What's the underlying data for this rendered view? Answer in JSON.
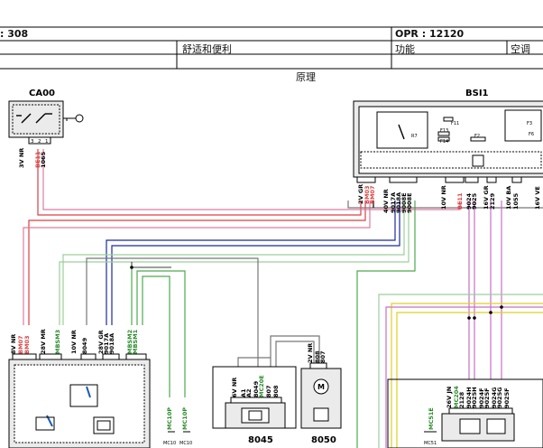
{
  "header": {
    "left_code": ": 308",
    "opr_code": "OPR : 12120",
    "category": "舒适和便利",
    "function_label": "功能",
    "function_value": "空调",
    "section_title": "原理"
  },
  "components": {
    "ca00": {
      "title": "CA00",
      "wire_labels": [
        "3V NR",
        "BE11",
        "1065"
      ],
      "pin_labels": [
        "3",
        "2",
        "1"
      ]
    },
    "bsi1": {
      "title": "BSI1",
      "internal_labels": [
        "R7",
        "F11",
        "F13",
        "F14",
        "F2",
        "F3",
        "F6"
      ],
      "conn_groups": [
        {
          "label": "2V GR",
          "wires": [
            "BM03",
            "BM07"
          ],
          "pins": [
            "1",
            "2"
          ]
        },
        {
          "label": "40V NR",
          "wires": [
            "9017A",
            "9018A",
            "9008E",
            "9008E"
          ],
          "pins": [
            "37",
            "21",
            "4",
            "3"
          ]
        },
        {
          "label": "10V NR",
          "wires": [
            "BE11"
          ],
          "pins": [
            "5",
            "9"
          ]
        },
        {
          "label": "",
          "wires": [
            "9024",
            "9025"
          ],
          "pins": [
            "8",
            "9"
          ]
        },
        {
          "label": "16V GR",
          "wires": [
            "2129"
          ],
          "pins": [
            "11"
          ]
        },
        {
          "label": "10V BA",
          "wires": [
            "1055"
          ],
          "pins": [
            "4"
          ]
        },
        {
          "label": "16V VE",
          "wires": [],
          "pins": []
        }
      ]
    },
    "left_module": {
      "groups": [
        {
          "label": "8V NR",
          "wires": [
            "BM07",
            "BM03"
          ],
          "pins": [
            "1",
            "2"
          ]
        },
        {
          "label": "28V MR",
          "wires": [
            "MBSM3"
          ],
          "pins": [
            "17"
          ]
        },
        {
          "label": "10V NR",
          "wires": [
            "8049"
          ],
          "pins": [
            "1",
            "2"
          ]
        },
        {
          "label": "28V GR",
          "wires": [
            "9017A",
            "9018A"
          ],
          "pins": [
            "11",
            "12"
          ]
        },
        {
          "label": "",
          "wires": [
            "MBSM2",
            "MBSM1"
          ],
          "pins": [
            "26",
            "25"
          ]
        }
      ],
      "bottom_labels": [
        "MC10P",
        "MC10P",
        "MC10",
        "MC10"
      ]
    },
    "m8045": {
      "title": "8045",
      "label": "6V NR",
      "wires": [
        "A1",
        "A2",
        "8049",
        "MC20E",
        "807",
        "808"
      ],
      "pins": [
        "1",
        "2",
        "3",
        "4",
        "5",
        "6"
      ]
    },
    "m8050": {
      "title": "8050",
      "label": "2V NR",
      "wires": [
        "808",
        "807"
      ],
      "pins": [
        "1",
        "2"
      ]
    },
    "right_module": {
      "label": "26V JN",
      "wires": [
        "MC51E",
        "MC204",
        "2128",
        "9024H",
        "9025H",
        "9024F",
        "9025F",
        "9024G",
        "9025G",
        "9025F"
      ],
      "pins": [
        "1",
        "2",
        "3",
        "4",
        "5",
        "6",
        "7",
        "8",
        "9"
      ],
      "bottom_label": "MC51"
    }
  },
  "colors": {
    "frame": "#000000",
    "red_wire": "#d94040",
    "pink_wire": "#e07aa0",
    "blue_wire": "#1b2a9a",
    "green_wire": "#4caa4c",
    "lightgreen_wire": "#9ad09a",
    "magenta_wire": "#c86ec8",
    "yellow_wire": "#e0d020",
    "grey_wire": "#777777",
    "module_fill": "#ebebeb"
  }
}
